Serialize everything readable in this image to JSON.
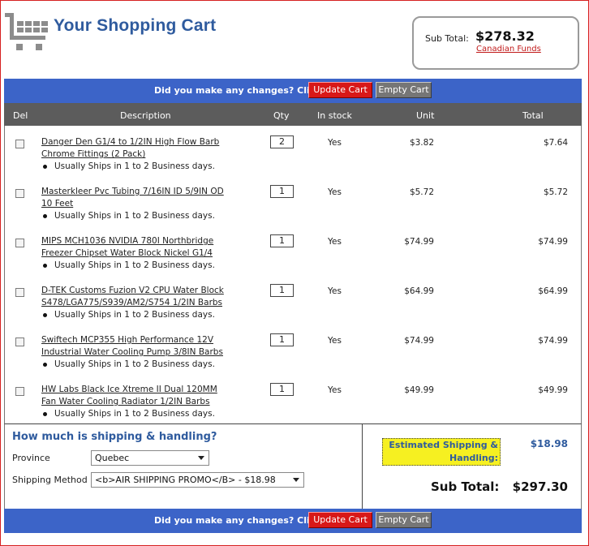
{
  "header": {
    "title": "Your Shopping Cart",
    "subtotal_label": "Sub Total:",
    "subtotal_value": "$278.32",
    "funds_link": "Canadian Funds"
  },
  "bar": {
    "prompt": "Did you make any changes? Click",
    "update_label": "Update Cart",
    "empty_label": "Empty Cart"
  },
  "table": {
    "headers": {
      "del": "Del",
      "description": "Description",
      "qty": "Qty",
      "instock": "In stock",
      "unit": "Unit",
      "total": "Total"
    },
    "items": [
      {
        "desc_line1": "Danger Den G1/4 to 1/2IN High Flow Barb",
        "desc_line2": "Chrome Fittings (2 Pack)",
        "ship": "Usually Ships in 1 to 2 Business days.",
        "qty": "2",
        "instock": "Yes",
        "unit": "$3.82",
        "total": "$7.64"
      },
      {
        "desc_line1": "Masterkleer Pvc Tubing 7/16IN ID 5/9IN OD",
        "desc_line2": "10 Feet",
        "ship": "Usually Ships in 1 to 2 Business days.",
        "qty": "1",
        "instock": "Yes",
        "unit": "$5.72",
        "total": "$5.72"
      },
      {
        "desc_line1": "MIPS MCH1036 NVIDIA 780I Northbridge",
        "desc_line2": "Freezer Chipset Water Block Nickel G1/4",
        "ship": "Usually Ships in 1 to 2 Business days.",
        "qty": "1",
        "instock": "Yes",
        "unit": "$74.99",
        "total": "$74.99"
      },
      {
        "desc_line1": "D-TEK Customs Fuzion V2 CPU Water Block",
        "desc_line2": "S478/LGA775/S939/AM2/S754 1/2IN Barbs",
        "ship": "Usually Ships in 1 to 2 Business days.",
        "qty": "1",
        "instock": "Yes",
        "unit": "$64.99",
        "total": "$64.99"
      },
      {
        "desc_line1": "Swiftech MCP355 High Performance 12V",
        "desc_line2": "Industrial Water Cooling Pump 3/8IN Barbs",
        "ship": "Usually Ships in 1 to 2 Business days.",
        "qty": "1",
        "instock": "Yes",
        "unit": "$74.99",
        "total": "$74.99"
      },
      {
        "desc_line1": "HW Labs Black Ice Xtreme II Dual 120MM",
        "desc_line2": "Fan Water Cooling Radiator 1/2IN Barbs",
        "ship": "Usually Ships in 1 to 2 Business days.",
        "qty": "1",
        "instock": "Yes",
        "unit": "$49.99",
        "total": "$49.99"
      }
    ]
  },
  "shipping": {
    "title": "How much is shipping & handling?",
    "province_label": "Province",
    "province_value": "Quebec",
    "method_label": "Shipping Method",
    "method_value": "<b>AIR SHIPPING PROMO</B> - $18.98",
    "estimate_line1": "Estimated Shipping &",
    "estimate_line2": "Handling:",
    "estimate_value": "$18.98",
    "grand_label": "Sub Total:",
    "grand_value": "$297.30"
  },
  "colors": {
    "accent_blue": "#3c64c8",
    "title_blue": "#2f5b9e",
    "update_red": "#d81818",
    "empty_gray": "#767676",
    "header_gray": "#5c5c5c",
    "highlight_yellow": "#f6f021"
  }
}
